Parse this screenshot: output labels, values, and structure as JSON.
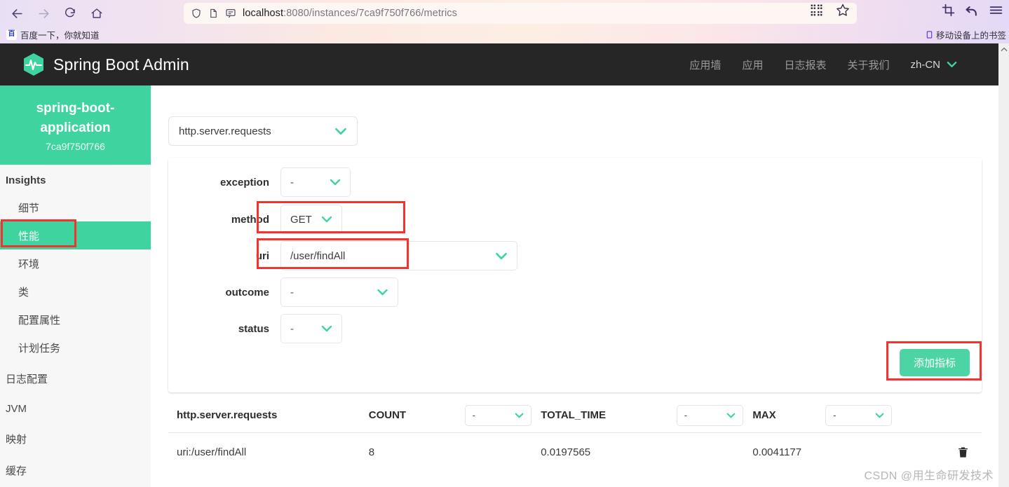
{
  "browser": {
    "back_icon": "back-arrow-icon",
    "forward_icon": "forward-arrow-icon",
    "reload_icon": "reload-icon",
    "home_icon": "home-icon",
    "shield_icon": "shield-icon",
    "page_icon": "page-icon",
    "reader_icon": "reader-view-icon",
    "url_host": "localhost",
    "url_path": ":8080/instances/7ca9f750f766/metrics",
    "url_full": "localhost:8080/instances/7ca9f750f766/metrics",
    "qr_icon": "qr-code-icon",
    "star_icon": "star-icon",
    "screenshot_icon": "screenshot-icon",
    "undo_icon": "undo-icon",
    "menu_icon": "hamburger-menu-icon",
    "bookmark_label": "百度一下，你就知道",
    "bookmark_favicon_text": "百",
    "mobile_bookmarks_label": "移动设备上的书签",
    "mobile_bookmarks_icon": "mobile-device-icon"
  },
  "header": {
    "logo_icon": "spring-boot-admin-pulse-logo",
    "title": "Spring Boot Admin",
    "nav": [
      {
        "label": "应用墙"
      },
      {
        "label": "应用"
      },
      {
        "label": "日志报表"
      },
      {
        "label": "关于我们"
      }
    ],
    "language": "zh-CN",
    "language_chevron_icon": "chevron-down-icon"
  },
  "sidebar": {
    "app_name": "spring-boot-application",
    "instance_id": "7ca9f750f766",
    "groups": [
      {
        "title": "Insights",
        "items": [
          {
            "label": "细节",
            "active": false
          },
          {
            "label": "性能",
            "active": true
          },
          {
            "label": "环境",
            "active": false
          },
          {
            "label": "类",
            "active": false
          },
          {
            "label": "配置属性",
            "active": false
          },
          {
            "label": "计划任务",
            "active": false
          }
        ]
      },
      {
        "title": "日志配置",
        "items": []
      },
      {
        "title": "JVM",
        "items": []
      },
      {
        "title": "映射",
        "items": []
      },
      {
        "title": "缓存",
        "items": []
      }
    ]
  },
  "main": {
    "metric_select": {
      "value": "http.server.requests",
      "chevron_icon": "chevron-down-icon"
    },
    "form": {
      "fields": [
        {
          "label": "exception",
          "value": "-",
          "chevron_icon": "chevron-down-icon"
        },
        {
          "label": "method",
          "value": "GET",
          "chevron_icon": "chevron-down-icon"
        },
        {
          "label": "uri",
          "value": "/user/findAll",
          "chevron_icon": "chevron-down-icon"
        },
        {
          "label": "outcome",
          "value": "-",
          "chevron_icon": "chevron-down-icon"
        },
        {
          "label": "status",
          "value": "-",
          "chevron_icon": "chevron-down-icon"
        }
      ],
      "submit_label": "添加指标"
    },
    "table": {
      "headers": {
        "name": "http.server.requests",
        "count": "COUNT",
        "count_filter": "-",
        "total_time": "TOTAL_TIME",
        "total_time_filter": "-",
        "max": "MAX",
        "max_filter": "-"
      },
      "rows": [
        {
          "name": "uri:/user/findAll",
          "count": "8",
          "total_time": "0.0197565",
          "max": "0.0041177",
          "delete_icon": "trash-icon"
        }
      ]
    }
  },
  "watermark": "CSDN @用生命研发技术",
  "colors": {
    "accent_green": "#3fd3a0",
    "button_green": "#4dd4a5",
    "header_dark": "#262626",
    "annotation_red": "#f5332e",
    "sidebar_bg": "#f7f7f7"
  }
}
